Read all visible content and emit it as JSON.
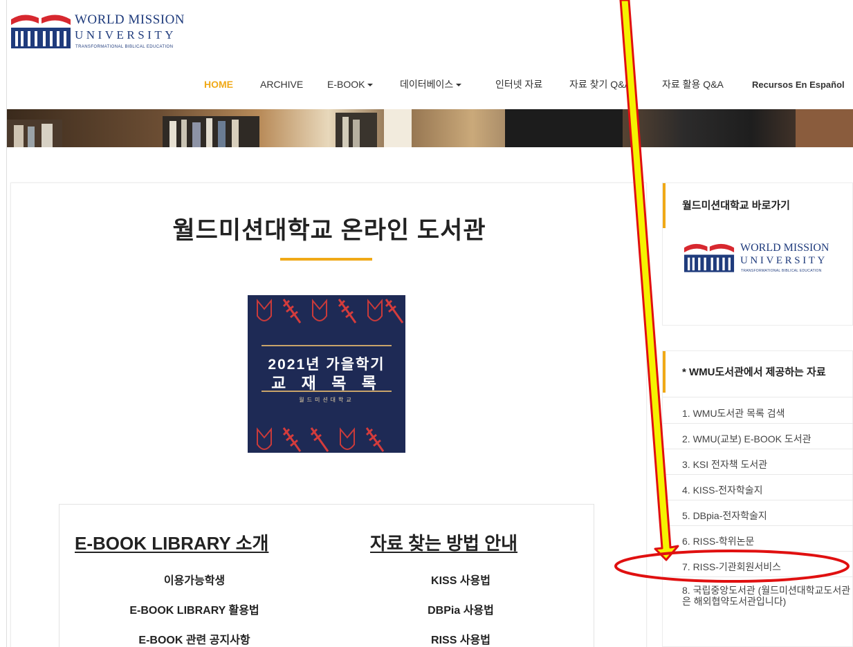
{
  "logo": {
    "line1": "WORLD MISSION",
    "line2": "UNIVERSITY",
    "tagline": "TRANSFORMATIONAL BIBLICAL EDUCATION",
    "brand_color": "#1f3b7c",
    "accent_red": "#d7282f"
  },
  "nav": {
    "items": [
      {
        "label": "HOME",
        "active": true
      },
      {
        "label": "ARCHIVE"
      },
      {
        "label": "E-BOOK",
        "dropdown": true
      },
      {
        "label": "데이터베이스",
        "dropdown": true
      },
      {
        "label": "인터넷 자료"
      },
      {
        "label": "자료 찾기 Q&A"
      },
      {
        "label": "자료 활용 Q&A"
      },
      {
        "label": "Recursos En Español"
      }
    ],
    "active_color": "#f0a917"
  },
  "main": {
    "title": "월드미션대학교 온라인 도서관",
    "poster": {
      "line1": "2021년 가을학기",
      "line2": "교 재 목 록",
      "line3": "월드미션대학교"
    },
    "col_left": {
      "heading": "E-BOOK LIBRARY 소개",
      "items": [
        "이용가능학생",
        "E-BOOK LIBRARY 활용법",
        "E-BOOK 관련 공지사항"
      ]
    },
    "col_right": {
      "heading": "자료 찾는 방법 안내",
      "items": [
        "KISS 사용법",
        "DBPia 사용법",
        "RISS 사용법"
      ]
    }
  },
  "sidebar": {
    "widget1": {
      "heading": "월드미션대학교 바로가기"
    },
    "widget2": {
      "heading": "* WMU도서관에서 제공하는 자료",
      "items": [
        "1. WMU도서관 목록 검색",
        "2. WMU(교보) E-BOOK 도서관",
        "3. KSI 전자책 도서관",
        "4. KISS-전자학술지",
        "5. DBpia-전자학술지",
        "6. RISS-학위논문",
        "7. RISS-기관회원서비스",
        "8. 국립중앙도서관 (월드미션대학교도서관은 해외협약도서관입니다)"
      ]
    }
  },
  "annotation": {
    "arrow_color": "#f5f200",
    "outline_color": "#e01010"
  }
}
